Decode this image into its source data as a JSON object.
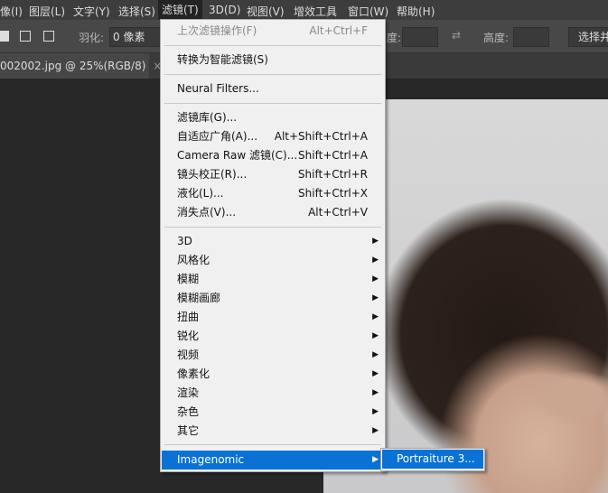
{
  "menubar": [
    "像(I)",
    "图层(L)",
    "文字(Y)",
    "选择(S)",
    "滤镜(T)",
    "3D(D)",
    "视图(V)",
    "增效工具",
    "窗口(W)",
    "帮助(H)"
  ],
  "options": {
    "feather_label": "羽化:",
    "feather_value": "0 像素",
    "width_label": "度:",
    "height_label": "高度:",
    "select_button": "选择并"
  },
  "tab": {
    "title": "002002.jpg @ 25%(RGB/8)",
    "close": "×"
  },
  "menu": {
    "last_filter": {
      "label": "上次滤镜操作(F)",
      "shortcut": "Alt+Ctrl+F"
    },
    "smart": "转换为智能滤镜(S)",
    "neural": "Neural Filters...",
    "group1": [
      {
        "label": "滤镜库(G)...",
        "shortcut": ""
      },
      {
        "label": "自适应广角(A)...",
        "shortcut": "Alt+Shift+Ctrl+A"
      },
      {
        "label": "Camera Raw 滤镜(C)...",
        "shortcut": "Shift+Ctrl+A"
      },
      {
        "label": "镜头校正(R)...",
        "shortcut": "Shift+Ctrl+R"
      },
      {
        "label": "液化(L)...",
        "shortcut": "Shift+Ctrl+X"
      },
      {
        "label": "消失点(V)...",
        "shortcut": "Alt+Ctrl+V"
      }
    ],
    "submenus": [
      "3D",
      "风格化",
      "模糊",
      "模糊画廊",
      "扭曲",
      "锐化",
      "视频",
      "像素化",
      "渲染",
      "杂色",
      "其它"
    ],
    "imagenomic": "Imagenomic",
    "arrow": "▶"
  },
  "submenu": {
    "portraiture": "Portraiture 3..."
  }
}
